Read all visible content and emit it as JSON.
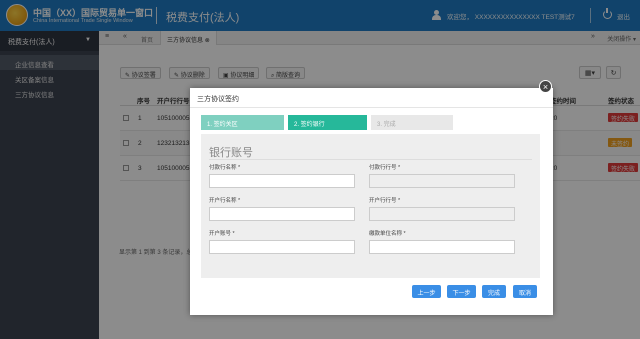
{
  "header": {
    "brand_cn": "中国（XX）国际贸易单一窗口",
    "brand_en": "China International Trade Single Window",
    "app_title": "税费支付(法人)",
    "welcome": "欢迎您，  XXXXXXXXXXXXXXX  TEST测试7",
    "logout": "退出"
  },
  "sidebar": {
    "title": "税费支付(法人)",
    "items": [
      {
        "label": "企业信息查看"
      },
      {
        "label": "关区备案信息"
      },
      {
        "label": "三方协议信息"
      }
    ]
  },
  "tabbar": {
    "menu_icon": "≡",
    "back_icon": "«",
    "home": "首页",
    "current": "三方协议信息",
    "forward_icon": "»",
    "close_ops": "关闭操作"
  },
  "toolbar": {
    "sign": "协议签署",
    "delete": "协议删除",
    "detail": "协议明细",
    "query": "简版查询"
  },
  "table": {
    "headers": {
      "seq": "序号",
      "bank": "开户行行号",
      "date": "签约时间",
      "status": "签约状态"
    },
    "rows": [
      {
        "seq": "1",
        "bank": "105100005",
        "date": "20",
        "status": "签约失败"
      },
      {
        "seq": "2",
        "bank": "123213213",
        "date": "",
        "status": "未签约"
      },
      {
        "seq": "3",
        "bank": "105100005",
        "date": "20",
        "status": "签约失败"
      }
    ]
  },
  "footer": {
    "text": "显示第 1 到第 3 条记录，总"
  },
  "modal": {
    "title": "三方协议签约",
    "close": "×",
    "steps": [
      {
        "label": "1. 签约关区"
      },
      {
        "label": "2. 签约银行"
      },
      {
        "label": "3. 完成"
      }
    ],
    "section_title": "银行账号",
    "fields": {
      "pay_bank_name": "付款行名称 *",
      "pay_bank_no": "付款行行号 *",
      "open_bank_name": "开户行名称 *",
      "open_bank_no": "开户行行号 *",
      "account_no": "开户账号 *",
      "unit_name": "缴款单位名称 *"
    },
    "buttons": {
      "prev": "上一步",
      "next": "下一步",
      "finish": "完成",
      "cancel": "取消"
    }
  },
  "colors": {
    "header_blue": "#1f7bc3",
    "sidebar_dark": "#3d4450",
    "step_done": "#7fd0c0",
    "step_active": "#26b89a",
    "step_pending": "#e8e8e8",
    "button_blue": "#3a8ee6",
    "status_failed": "#e03b3b",
    "status_unsigned": "#f0a020"
  }
}
